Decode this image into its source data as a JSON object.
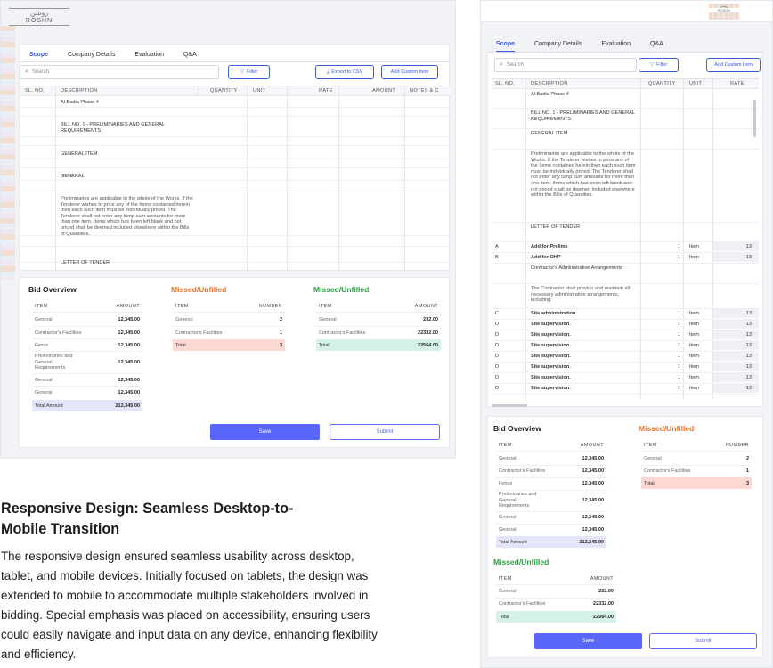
{
  "brand": {
    "logo_ar": "روشن",
    "logo_en": "ROSHN"
  },
  "tabs": [
    "Scope",
    "Company Details",
    "Evaluation",
    "Q&A"
  ],
  "search": {
    "placeholder": "Search"
  },
  "buttons": {
    "filter": "Filter",
    "export": "Export to CSV",
    "add_custom": "Add Custom Item",
    "save": "Save",
    "submit": "Submit"
  },
  "columns": [
    "SL. NO.",
    "DESCRIPTION",
    "QUANTITY",
    "UNIT",
    "RATE",
    "AMOUNT",
    "NOTES & C"
  ],
  "desktop_rows": [
    {
      "desc": "Al Badia Phase 4"
    },
    {
      "desc": "BILL NO. 1 - PRELIMINARIES AND GENERAL REQUIREMENTS"
    },
    {
      "desc": "GENERAL ITEM"
    },
    {
      "desc": "GENERAL"
    },
    {
      "desc": "Preliminaries are applicable to the whole of the Works. If the Tenderer wishes to price any of the Items contained herein then each such item must be individually priced. The Tenderer shall not enter any lump sum amounts for more than one item. Items which has been left blank and not priced shall be deemed included elsewhere within the Bills of Quantities."
    },
    {
      "desc": "LETTER OF TENDER"
    }
  ],
  "mobile_rows": [
    {
      "sl": "",
      "desc": "Al Badia Phase 4",
      "qty": "",
      "unit": "",
      "rate": ""
    },
    {
      "sl": "",
      "desc": "BILL NO. 1 - PRELIMINARIES AND GENERAL REQUIREMENTS",
      "qty": "",
      "unit": "",
      "rate": ""
    },
    {
      "sl": "",
      "desc": "GENERAL ITEM",
      "qty": "",
      "unit": "",
      "rate": ""
    },
    {
      "sl": "",
      "desc": "Preliminaries are applicable to the whole of the Works. If the Tenderer wishes to price any of the Items contained herein then each such item must be individually priced. The Tenderer shall not enter any lump sum amounts for more than one item. Items which has been left blank and not priced shall be deemed included elsewhere within the Bills of Quantities.",
      "qty": "",
      "unit": "",
      "rate": ""
    },
    {
      "sl": "",
      "desc": "LETTER OF TENDER",
      "qty": "",
      "unit": "",
      "rate": ""
    },
    {
      "sl": "A",
      "desc": "Add for Prelims",
      "qty": "1",
      "unit": "Item",
      "rate": "13"
    },
    {
      "sl": "B",
      "desc": "Add for OHP",
      "qty": "1",
      "unit": "Item",
      "rate": "13"
    },
    {
      "sl": "",
      "desc": "Contractor's Administrative Arrangements",
      "qty": "",
      "unit": "",
      "rate": ""
    },
    {
      "sl": "",
      "desc": "The Contractor shall provide and maintain all necessary administrative arrangements, including:",
      "qty": "",
      "unit": "",
      "rate": ""
    },
    {
      "sl": "C",
      "desc": "Site administration.",
      "qty": "1",
      "unit": "Item",
      "rate": "13"
    },
    {
      "sl": "D",
      "desc": "Site supervision.",
      "qty": "1",
      "unit": "Item",
      "rate": "13"
    },
    {
      "sl": "D",
      "desc": "Site supervision.",
      "qty": "1",
      "unit": "Item",
      "rate": "13"
    },
    {
      "sl": "D",
      "desc": "Site supervision.",
      "qty": "1",
      "unit": "Item",
      "rate": "13"
    },
    {
      "sl": "D",
      "desc": "Site supervision.",
      "qty": "1",
      "unit": "Item",
      "rate": "13"
    },
    {
      "sl": "D",
      "desc": "Site supervision.",
      "qty": "1",
      "unit": "Item",
      "rate": "13"
    },
    {
      "sl": "D",
      "desc": "Site supervision.",
      "qty": "1",
      "unit": "Item",
      "rate": "13"
    },
    {
      "sl": "D",
      "desc": "Site supervision.",
      "qty": "1",
      "unit": "Item",
      "rate": "13"
    }
  ],
  "bid_overview": {
    "title": "Bid Overview",
    "col_item": "ITEM",
    "col_amount": "AMOUNT",
    "rows": [
      {
        "item": "General",
        "amount": "12,345.00"
      },
      {
        "item": "Contractor's Facilities",
        "amount": "12,345.00"
      },
      {
        "item": "Fence",
        "amount": "12,345.00"
      },
      {
        "item": "Preliminaries and General Requirements",
        "amount": "12,345.00"
      },
      {
        "item": "General",
        "amount": "12,345.00"
      },
      {
        "item": "General",
        "amount": "12,345.00"
      }
    ],
    "total_label": "Total Amount",
    "total": "212,345.00"
  },
  "missed_number": {
    "title": "Missed/Unfilled",
    "col_item": "ITEM",
    "col_number": "NUMBER",
    "rows": [
      {
        "item": "General",
        "value": "2"
      },
      {
        "item": "Contractor's Facilities",
        "value": "1"
      }
    ],
    "total_label": "Total",
    "total": "3"
  },
  "missed_amount": {
    "title": "Missed/Unfilled",
    "col_item": "ITEM",
    "col_amount": "AMOUNT",
    "rows": [
      {
        "item": "General",
        "value": "232.00"
      },
      {
        "item": "Contractor's Facilities",
        "value": "22332.00"
      }
    ],
    "total_label": "Total",
    "total": "22564.00"
  },
  "article": {
    "heading": "Responsive Design: Seamless Desktop-to-Mobile Transition",
    "body": "The responsive design ensured seamless usability across desktop, tablet, and mobile devices. Initially focused on tablets, the design was extended to mobile to accommodate multiple stakeholders involved in bidding. Special emphasis was placed on accessibility, ensuring users could easily navigate and input data on any device, enhancing flexibility and efficiency."
  },
  "colors": {
    "primary": "#5867f7",
    "accent_blue": "#3b5bdb",
    "orange": "#e8742c",
    "green": "#2f9e44",
    "red_fill": "#fbd9d2",
    "green_fill": "#d3f1e4",
    "purple_fill": "#e3e5fb"
  }
}
